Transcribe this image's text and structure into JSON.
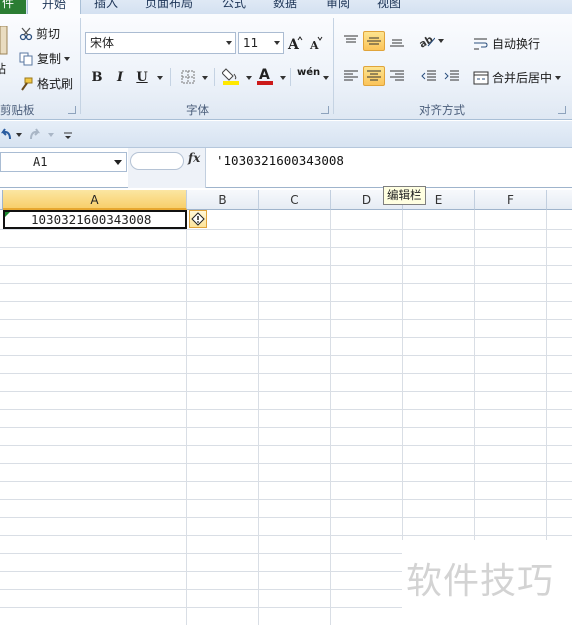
{
  "tabs": [
    {
      "label": "件"
    },
    {
      "label": "开始"
    },
    {
      "label": "插入"
    },
    {
      "label": "页面布局"
    },
    {
      "label": "公式"
    },
    {
      "label": "数据"
    },
    {
      "label": "审阅"
    },
    {
      "label": "视图"
    }
  ],
  "clipboard": {
    "paste_fragment": "粘",
    "cut": "剪切",
    "copy": "复制",
    "format_painter": "格式刷",
    "group_label": "剪贴板"
  },
  "font": {
    "name": "宋体",
    "size": "11",
    "bold": "B",
    "italic": "I",
    "underline": "U",
    "phonetic": "wén",
    "group_label": "字体",
    "font_color": "#cc1a1a",
    "fill_color": "#ffe800"
  },
  "alignment": {
    "wrap_text": "自动换行",
    "merge_center": "合并后居中",
    "group_label": "对齐方式"
  },
  "formula_bar": {
    "name_box": "A1",
    "fx": "fx",
    "content": "'1030321600343008"
  },
  "grid": {
    "columns": [
      "A",
      "B",
      "C",
      "D",
      "E",
      "F"
    ],
    "selected_column": "A",
    "a1_value": "1030321600343008",
    "tooltip": "编辑栏"
  },
  "watermark": "软件技巧",
  "colors": {
    "accent": "#2b7d33",
    "selected_header": "#f8cf6b",
    "ribbon_bg": "#eef3fa"
  }
}
